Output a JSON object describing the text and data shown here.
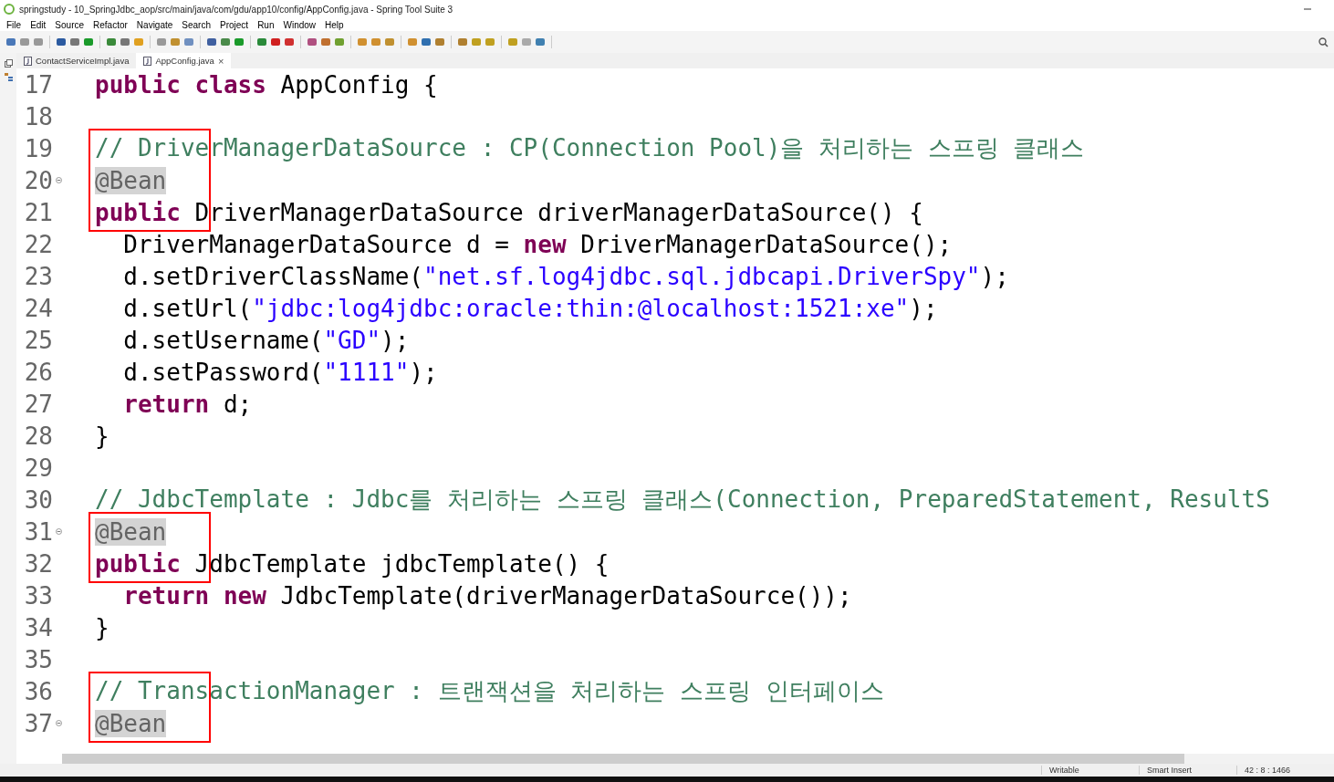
{
  "window": {
    "title": "springstudy - 10_SpringJdbc_aop/src/main/java/com/gdu/app10/config/AppConfig.java - Spring Tool Suite 3"
  },
  "menu": [
    "File",
    "Edit",
    "Source",
    "Refactor",
    "Navigate",
    "Search",
    "Project",
    "Run",
    "Window",
    "Help"
  ],
  "tabs": [
    {
      "label": "ContactServiceImpl.java",
      "selected": false,
      "closable": false
    },
    {
      "label": "AppConfig.java",
      "selected": true,
      "closable": true
    }
  ],
  "close_glyph": "×",
  "editor": {
    "lines": [
      {
        "number": "17",
        "fold": false,
        "framed": false,
        "tokens": [
          {
            "kind": "keyword",
            "text": "public "
          },
          {
            "kind": "keyword",
            "text": "class"
          },
          {
            "kind": "plain",
            "text": " AppConfig {"
          }
        ]
      },
      {
        "number": "18",
        "fold": false,
        "framed": false
      },
      {
        "number": "19",
        "fold": false,
        "framed": true,
        "tokens": [
          {
            "kind": "comment",
            "text": "// DriverManagerDataSource : CP(Connection Pool)을 처리하는 스프링 클래스"
          }
        ]
      },
      {
        "number": "20",
        "fold": true,
        "framed": true,
        "tokens": [
          {
            "kind": "annotation",
            "text": "@Bean",
            "marked": true
          }
        ]
      },
      {
        "number": "21",
        "fold": false,
        "framed": true,
        "tokens": [
          {
            "kind": "keyword",
            "text": "public"
          },
          {
            "kind": "plain",
            "text": " DriverManagerDataSource driverManagerDataSource() {"
          }
        ]
      },
      {
        "number": "22",
        "fold": false,
        "framed": false,
        "tokens": [
          {
            "kind": "plain",
            "text": "  DriverManagerDataSource d = "
          },
          {
            "kind": "keyword",
            "text": "new"
          },
          {
            "kind": "plain",
            "text": " DriverManagerDataSource();"
          }
        ]
      },
      {
        "number": "23",
        "fold": false,
        "framed": false,
        "tokens": [
          {
            "kind": "plain",
            "text": "  d.setDriverClassName("
          },
          {
            "kind": "string",
            "text": "\"net.sf.log4jdbc.sql.jdbcapi.DriverSpy\""
          },
          {
            "kind": "plain",
            "text": ");"
          }
        ]
      },
      {
        "number": "24",
        "fold": false,
        "framed": false,
        "tokens": [
          {
            "kind": "plain",
            "text": "  d.setUrl("
          },
          {
            "kind": "string",
            "text": "\"jdbc:log4jdbc:oracle:thin:@localhost:1521:xe\""
          },
          {
            "kind": "plain",
            "text": ");"
          }
        ]
      },
      {
        "number": "25",
        "fold": false,
        "framed": false,
        "tokens": [
          {
            "kind": "plain",
            "text": "  d.setUsername("
          },
          {
            "kind": "string",
            "text": "\"GD\""
          },
          {
            "kind": "plain",
            "text": ");"
          }
        ]
      },
      {
        "number": "26",
        "fold": false,
        "framed": false,
        "tokens": [
          {
            "kind": "plain",
            "text": "  d.setPassword("
          },
          {
            "kind": "string",
            "text": "\"1111\""
          },
          {
            "kind": "plain",
            "text": ");"
          }
        ]
      },
      {
        "number": "27",
        "fold": false,
        "framed": false,
        "tokens": [
          {
            "kind": "keyword",
            "text": "  return"
          },
          {
            "kind": "plain",
            "text": " d;"
          }
        ]
      },
      {
        "number": "28",
        "fold": false,
        "framed": false,
        "tokens": [
          {
            "kind": "plain",
            "text": "}"
          }
        ]
      },
      {
        "number": "29",
        "fold": false,
        "framed": false
      },
      {
        "number": "30",
        "fold": false,
        "framed": false,
        "tokens": [
          {
            "kind": "comment",
            "text": "// JdbcTemplate : Jdbc를 처리하는 스프링 클래스(Connection, PreparedStatement, ResultS"
          }
        ]
      },
      {
        "number": "31",
        "fold": true,
        "framed": true,
        "tokens": [
          {
            "kind": "annotation",
            "text": "@Bean",
            "marked": true
          }
        ]
      },
      {
        "number": "32",
        "fold": false,
        "framed": true,
        "tokens": [
          {
            "kind": "keyword",
            "text": "public"
          },
          {
            "kind": "plain",
            "text": " JdbcTemplate jdbcTemplate() {"
          }
        ]
      },
      {
        "number": "33",
        "fold": false,
        "framed": false,
        "tokens": [
          {
            "kind": "keyword",
            "text": "  return "
          },
          {
            "kind": "keyword",
            "text": "new"
          },
          {
            "kind": "plain",
            "text": " JdbcTemplate(driverManagerDataSource());"
          }
        ]
      },
      {
        "number": "34",
        "fold": false,
        "framed": false,
        "tokens": [
          {
            "kind": "plain",
            "text": "}"
          }
        ]
      },
      {
        "number": "35",
        "fold": false,
        "framed": false
      },
      {
        "number": "36",
        "fold": false,
        "framed": true,
        "tokens": [
          {
            "kind": "comment",
            "text": "// TransactionManager : 트랜잭션을 처리하는 스프링 인터페이스"
          }
        ]
      },
      {
        "number": "37",
        "fold": true,
        "framed": true,
        "tokens": [
          {
            "kind": "annotation",
            "text": "@Bean",
            "marked": true
          }
        ]
      }
    ]
  },
  "status_bar": [
    "Writable",
    "Smart Insert",
    "42 : 8 : 1466"
  ]
}
